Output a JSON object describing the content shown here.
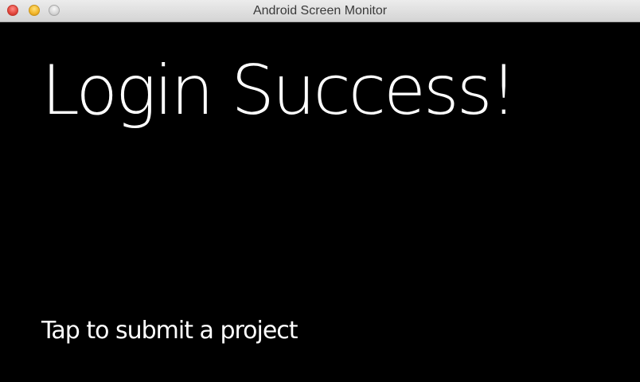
{
  "window": {
    "title": "Android Screen Monitor"
  },
  "screen": {
    "headline": "Login Success!",
    "action_text": "Tap to submit a project"
  },
  "colors": {
    "background": "#000000",
    "text": "#ffffff",
    "titlebar": "#e0e0e0"
  }
}
